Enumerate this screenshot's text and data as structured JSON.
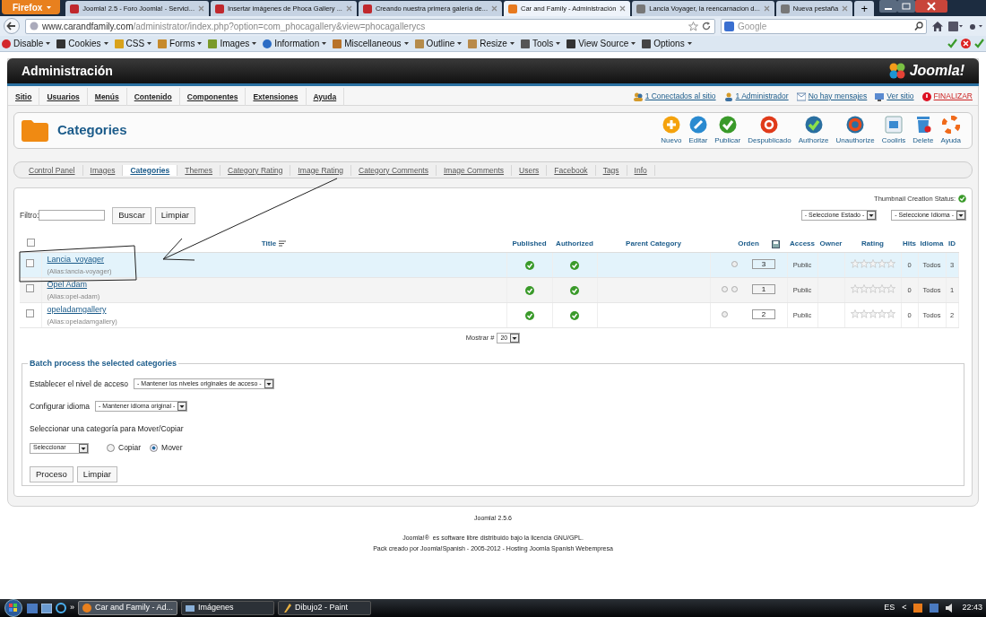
{
  "browser": {
    "menu_button": "Firefox",
    "tabs": [
      {
        "label": "Joomla! 2.5 - Foro Joomla! - Servici...",
        "selected": false
      },
      {
        "label": "Insertar imágenes de Phoca Gallery ...",
        "selected": false
      },
      {
        "label": "Creando nuestra primera galería de...",
        "selected": false
      },
      {
        "label": "Car and Family - Administración",
        "selected": true
      },
      {
        "label": "Lancia Voyager, la reencarnacion d...",
        "selected": false
      },
      {
        "label": "Nueva pestaña",
        "selected": false
      }
    ],
    "new_tab": "+",
    "address": "**www.carandfamily.com**/administrator/index.php?option=com_phocagallery&view=phocagallerycs",
    "search": {
      "placeholder": "Google"
    },
    "toolbar": [
      "Disable",
      "Cookies",
      "CSS",
      "Forms",
      "Images",
      "Information",
      "Miscellaneous",
      "Outline",
      "Resize",
      "Tools",
      "View Source",
      "Options"
    ]
  },
  "admin": {
    "title": "Administración",
    "logo": "Joomla!",
    "menu": [
      "Sitio",
      "Usuarios",
      "Menús",
      "Contenido",
      "Componentes",
      "Extensiones",
      "Ayuda"
    ],
    "status": [
      {
        "kind": "users",
        "label": "1 Conectados al sitio"
      },
      {
        "kind": "admin",
        "label": "1 Administrador"
      },
      {
        "kind": "messages",
        "label": "No hay mensajes"
      },
      {
        "kind": "site",
        "label": "Ver sitio"
      },
      {
        "kind": "logout",
        "label": "FINALIZAR"
      }
    ]
  },
  "page": {
    "title": "Categories",
    "toolbar": [
      {
        "kind": "new",
        "label": "Nuevo"
      },
      {
        "kind": "edit",
        "label": "Editar"
      },
      {
        "kind": "publish",
        "label": "Publicar"
      },
      {
        "kind": "unpublish",
        "label": "Despublicado"
      },
      {
        "kind": "authorize",
        "label": "Authorize"
      },
      {
        "kind": "unauthorize",
        "label": "Unauthorize"
      },
      {
        "kind": "cooliris",
        "label": "Cooliris"
      },
      {
        "kind": "delete",
        "label": "Delete"
      },
      {
        "kind": "help",
        "label": "Ayuda"
      }
    ]
  },
  "submenu": [
    {
      "label": "Control Panel",
      "selected": false
    },
    {
      "label": "Images",
      "selected": false
    },
    {
      "label": "Categories",
      "selected": true
    },
    {
      "label": "Themes",
      "selected": false
    },
    {
      "label": "Category Rating",
      "selected": false
    },
    {
      "label": "Image Rating",
      "selected": false
    },
    {
      "label": "Category Comments",
      "selected": false
    },
    {
      "label": "Image Comments",
      "selected": false
    },
    {
      "label": "Users",
      "selected": false
    },
    {
      "label": "Facebook",
      "selected": false
    },
    {
      "label": "Tags",
      "selected": false
    },
    {
      "label": "Info",
      "selected": false
    }
  ],
  "thumbnail_status": "Thumbnail Creation Status:",
  "filter": {
    "label": "Filtro:",
    "buttons": [
      "Buscar",
      "Limpiar"
    ],
    "selects": [
      "- Seleccione Estado -",
      "- Seleccione Idioma -"
    ]
  },
  "table": {
    "select_all": {
      "checked": false
    },
    "columns": [
      "Title",
      "Published",
      "Authorized",
      "Parent Category",
      "Orden",
      "Access",
      "Owner",
      "Rating",
      "Hits",
      "Idioma",
      "ID"
    ],
    "rows": [
      {
        "title": "Lancia_voyager",
        "alias": "(Alias:lancia-voyager)",
        "checked": false,
        "selected": true,
        "published": true,
        "authorized": true,
        "move_up": false,
        "move_down": true,
        "order": "3",
        "access": "Public",
        "stars": 0,
        "hits": "0",
        "language": "Todos",
        "id": "3"
      },
      {
        "title": "Opel Adam",
        "alias": "(Alias:opel-adam)",
        "checked": false,
        "selected": false,
        "published": true,
        "authorized": true,
        "move_up": true,
        "move_down": true,
        "order": "1",
        "access": "Public",
        "stars": 0,
        "hits": "0",
        "language": "Todos",
        "id": "1"
      },
      {
        "title": "opeladamgallery",
        "alias": "(Alias:opeladamgallery)",
        "checked": false,
        "selected": false,
        "published": true,
        "authorized": true,
        "move_up": true,
        "move_down": false,
        "order": "2",
        "access": "Public",
        "stars": 0,
        "hits": "0",
        "language": "Todos",
        "id": "2"
      }
    ]
  },
  "pagination": {
    "label": "Mostrar #",
    "value": "20"
  },
  "batch": {
    "legend": "Batch process the selected categories",
    "access": {
      "label": "Establecer el nivel de acceso",
      "value": "- Mantener los niveles originales de acceso -"
    },
    "language": {
      "label": "Configurar idioma",
      "value": "- Mantener idioma original -"
    },
    "category": {
      "label": "Seleccionar una categoría para Mover/Copiar",
      "value": "Seleccionar"
    },
    "mode": [
      {
        "label": "Copiar",
        "selected": false
      },
      {
        "label": "Mover",
        "selected": true
      }
    ],
    "buttons": [
      "Proceso",
      "Limpiar"
    ]
  },
  "footer": {
    "version": "Joomla! 2.5.6",
    "license_link": "Joomla!®",
    "license_text": "es software libre distribuido bajo la licencia GNU/GPL.",
    "credit": "Pack creado por Joomla!Spanish - 2005-2012 - Hosting Joomla Spanish Webempresa"
  },
  "taskbar": {
    "more": "»",
    "tasks": [
      {
        "kind": "firefox",
        "label": "Car and Family - Ad...",
        "selected": true
      },
      {
        "kind": "folder",
        "label": "Imágenes",
        "selected": false
      },
      {
        "kind": "paint",
        "label": "Dibujo2 - Paint",
        "selected": false
      }
    ],
    "language": "ES",
    "tray_expand": "<",
    "time": "22:43"
  }
}
